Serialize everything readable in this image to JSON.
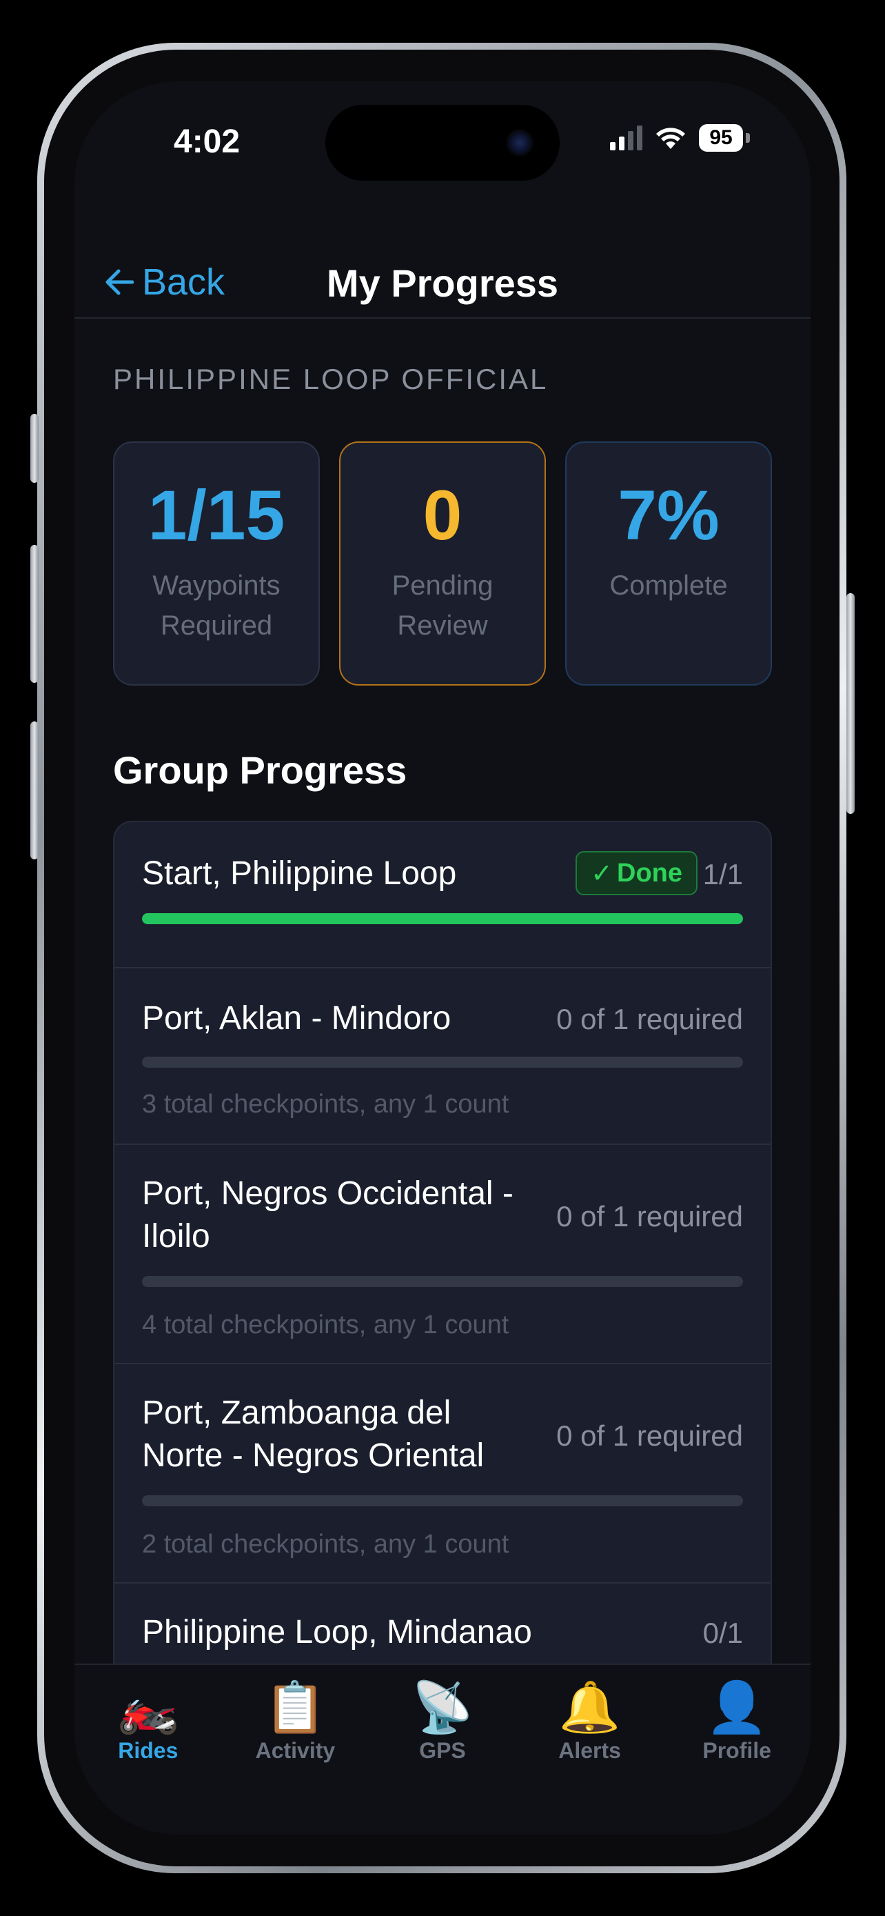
{
  "status_bar": {
    "time": "4:02",
    "battery": "95"
  },
  "nav": {
    "back_label": "Back",
    "title": "My Progress"
  },
  "section_label": "PHILIPPINE LOOP OFFICIAL",
  "stats": [
    {
      "value": "1/15",
      "label": "Waypoints Required",
      "color": "#35a7e6"
    },
    {
      "value": "0",
      "label": "Pending Review",
      "color": "#f5b82e"
    },
    {
      "value": "7%",
      "label": "Complete",
      "color": "#35a7e6"
    }
  ],
  "group_title": "Group Progress",
  "groups": [
    {
      "name": "Start, Philippine Loop",
      "badge": "Done",
      "count": "1/1",
      "progress": 1.0
    },
    {
      "name": "Port, Aklan - Mindoro",
      "required": "0 of 1 required",
      "progress": 0,
      "note": "3 total checkpoints, any 1 count"
    },
    {
      "name_line1": "Port, Negros Occidental -",
      "name_line2": "Iloilo",
      "required": "0 of 1 required",
      "progress": 0,
      "note": "4 total checkpoints, any 1 count"
    },
    {
      "name_line1": "Port, Zamboanga del",
      "name_line2": "Norte - Negros Oriental",
      "required": "0 of 1 required",
      "progress": 0,
      "note": "2 total checkpoints, any 1 count"
    },
    {
      "name": "Philippine Loop, Mindanao",
      "count": "0/1"
    }
  ],
  "tabs": [
    {
      "icon": "🏍️",
      "label": "Rides"
    },
    {
      "icon": "📋",
      "label": "Activity"
    },
    {
      "icon": "📡",
      "label": "GPS"
    },
    {
      "icon": "🔔",
      "label": "Alerts"
    },
    {
      "icon": "👤",
      "label": "Profile"
    }
  ],
  "colors": {
    "accent": "#35a7e6",
    "success": "#22c55e",
    "warning": "#f5b82e"
  }
}
